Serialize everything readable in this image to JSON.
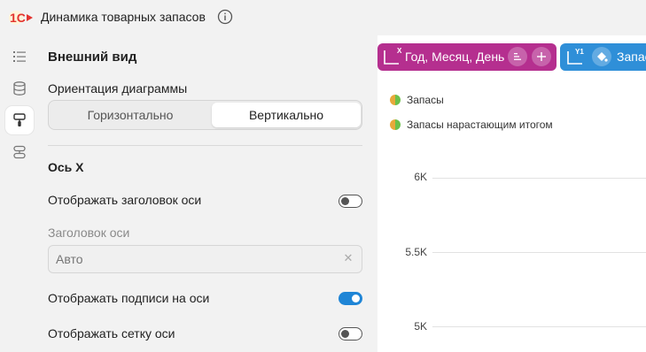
{
  "header": {
    "title": "Динамика товарных запасов",
    "logo_text": "1C",
    "brand_color": "#e3342f"
  },
  "rail": {
    "items": [
      {
        "icon": "list-icon",
        "active": false
      },
      {
        "icon": "database-icon",
        "active": false
      },
      {
        "icon": "brush-icon",
        "active": true
      },
      {
        "icon": "layers-icon",
        "active": false
      }
    ]
  },
  "settings": {
    "section_title": "Внешний вид",
    "orientation": {
      "label": "Ориентация диаграммы",
      "options": [
        "Горизонтально",
        "Вертикально"
      ],
      "selected": "Вертикально"
    },
    "axis_x": {
      "title": "Ось X",
      "show_axis_title": {
        "label": "Отображать заголовок оси",
        "value": false
      },
      "axis_title_field": {
        "label": "Заголовок оси",
        "placeholder": "Авто"
      },
      "show_axis_labels": {
        "label": "Отображать подписи на оси",
        "value": true
      },
      "show_axis_grid": {
        "label": "Отображать сетку оси",
        "value": false
      }
    }
  },
  "chart": {
    "x_chip": {
      "badge": "X",
      "label": "Год, Месяц, День",
      "color": "#b52f8f"
    },
    "y_chip": {
      "badge": "Y1",
      "label": "Запасы",
      "color": "#2f8fd8"
    },
    "legend": [
      "Запасы",
      "Запасы нарастающим итогом"
    ],
    "y_ticks": [
      "6K",
      "5.5K",
      "5K"
    ]
  },
  "chart_data": {
    "type": "line",
    "series": [
      {
        "name": "Запасы",
        "values": []
      },
      {
        "name": "Запасы нарастающим итогом",
        "values": []
      }
    ],
    "y_ticks": [
      6000,
      5500,
      5000
    ],
    "grid": true,
    "legend": "top-left"
  }
}
